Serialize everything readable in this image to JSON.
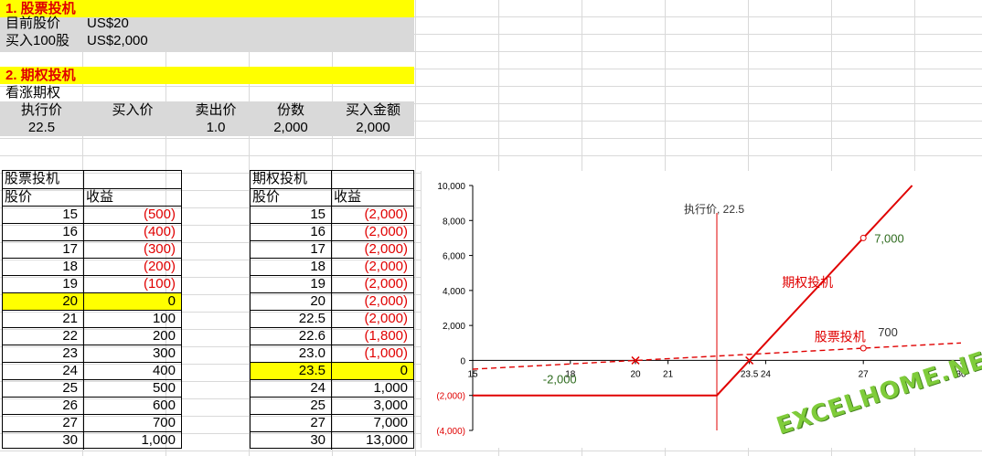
{
  "section1": {
    "title": "1. 股票投机",
    "rows": [
      {
        "label": "目前股价",
        "value": "US$20"
      },
      {
        "label": "买入100股",
        "value": "US$2,000"
      }
    ]
  },
  "section2": {
    "title": "2. 期权投机",
    "subtitle": "看涨期权",
    "headers": [
      "执行价",
      "买入价",
      "卖出价",
      "份数",
      "买入金额"
    ],
    "values": [
      "22.5",
      "",
      "1.0",
      "2,000",
      "2,000"
    ]
  },
  "stock_table": {
    "title": "股票投机",
    "col1": "股价",
    "col2": "收益",
    "rows": [
      {
        "price": "15",
        "profit": "(500)",
        "neg": true
      },
      {
        "price": "16",
        "profit": "(400)",
        "neg": true
      },
      {
        "price": "17",
        "profit": "(300)",
        "neg": true
      },
      {
        "price": "18",
        "profit": "(200)",
        "neg": true
      },
      {
        "price": "19",
        "profit": "(100)",
        "neg": true
      },
      {
        "price": "20",
        "profit": "0",
        "neg": false,
        "highlight": true
      },
      {
        "price": "21",
        "profit": "100",
        "neg": false
      },
      {
        "price": "22",
        "profit": "200",
        "neg": false
      },
      {
        "price": "23",
        "profit": "300",
        "neg": false
      },
      {
        "price": "24",
        "profit": "400",
        "neg": false
      },
      {
        "price": "25",
        "profit": "500",
        "neg": false
      },
      {
        "price": "26",
        "profit": "600",
        "neg": false
      },
      {
        "price": "27",
        "profit": "700",
        "neg": false
      },
      {
        "price": "30",
        "profit": "1,000",
        "neg": false
      }
    ]
  },
  "option_table": {
    "title": "期权投机",
    "col1": "股价",
    "col2": "收益",
    "rows": [
      {
        "price": "15",
        "profit": "(2,000)",
        "neg": true
      },
      {
        "price": "16",
        "profit": "(2,000)",
        "neg": true
      },
      {
        "price": "17",
        "profit": "(2,000)",
        "neg": true
      },
      {
        "price": "18",
        "profit": "(2,000)",
        "neg": true
      },
      {
        "price": "19",
        "profit": "(2,000)",
        "neg": true
      },
      {
        "price": "20",
        "profit": "(2,000)",
        "neg": true
      },
      {
        "price": "22.5",
        "profit": "(2,000)",
        "neg": true
      },
      {
        "price": "22.6",
        "profit": "(1,800)",
        "neg": true
      },
      {
        "price": "23.0",
        "profit": "(1,000)",
        "neg": true
      },
      {
        "price": "23.5",
        "profit": "0",
        "neg": false,
        "highlight": true
      },
      {
        "price": "24",
        "profit": "1,000",
        "neg": false
      },
      {
        "price": "25",
        "profit": "3,000",
        "neg": false
      },
      {
        "price": "27",
        "profit": "7,000",
        "neg": false
      },
      {
        "price": "30",
        "profit": "13,000",
        "neg": false
      }
    ]
  },
  "chart_data": {
    "type": "line",
    "xlim": [
      15,
      30
    ],
    "ylim": [
      -4000,
      10000
    ],
    "xticks": [
      "15",
      "18",
      "20",
      "21",
      "23.5",
      "24",
      "27",
      "30"
    ],
    "xtick_values": [
      15,
      18,
      20,
      21,
      23.5,
      24,
      27,
      30
    ],
    "yticks": [
      "10,000",
      "8,000",
      "6,000",
      "4,000",
      "2,000",
      "0",
      "(2,000)",
      "(4,000)"
    ],
    "ytick_values": [
      10000,
      8000,
      6000,
      4000,
      2000,
      0,
      -2000,
      -4000
    ],
    "strike_line": {
      "x": 22.5,
      "label": "执行价, 22.5"
    },
    "series": [
      {
        "name": "期权投机",
        "style": "solid",
        "color": "#e00000",
        "x": [
          15,
          22.5,
          23.5,
          28.5
        ],
        "y": [
          -2000,
          -2000,
          0,
          10000
        ]
      },
      {
        "name": "股票投机",
        "style": "dashed",
        "color": "#e00000",
        "x": [
          15,
          30
        ],
        "y": [
          -500,
          1000
        ]
      }
    ],
    "annotations": [
      {
        "text": "-2,000",
        "x": 18,
        "y": -1300,
        "color": "#2e6b1e"
      },
      {
        "text": "7,000",
        "x": 27,
        "y": 7000,
        "color": "#2e6b1e",
        "marker": true,
        "dx": 12,
        "dy": 0
      },
      {
        "text": "700",
        "x": 27,
        "y": 700,
        "color": "#333333",
        "marker": true,
        "dx": 16,
        "dy": -18
      }
    ],
    "crosses": [
      {
        "x": 20,
        "y": 0
      },
      {
        "x": 23.5,
        "y": 0
      }
    ],
    "accent": "#e00000"
  },
  "watermark": "EXCELHOME.NET"
}
